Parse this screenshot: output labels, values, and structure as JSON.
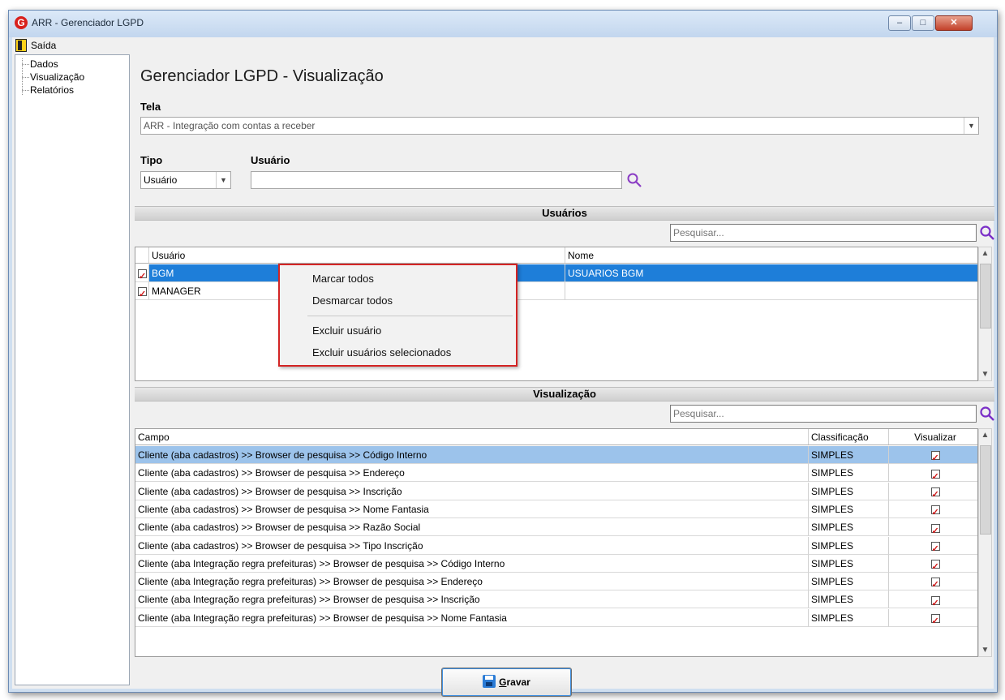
{
  "window": {
    "title": "ARR - Gerenciador LGPD",
    "logo_letter": "G",
    "controls": {
      "minimize": "–",
      "maximize": "□",
      "close": "✕"
    }
  },
  "menubar": {
    "exit_label": "Saída"
  },
  "tree": {
    "items": [
      "Dados",
      "Visualização",
      "Relatórios"
    ]
  },
  "page": {
    "title": "Gerenciador LGPD - Visualização"
  },
  "tela": {
    "label": "Tela",
    "value": "ARR - Integração com contas a receber"
  },
  "tipo": {
    "label": "Tipo",
    "value": "Usuário"
  },
  "usuario": {
    "label": "Usuário",
    "value": ""
  },
  "users_section": {
    "title": "Usuários",
    "search_placeholder": "Pesquisar...",
    "columns": [
      "Usuário",
      "Nome"
    ],
    "rows": [
      {
        "checked": true,
        "user": "BGM",
        "name": "USUARIOS BGM"
      },
      {
        "checked": true,
        "user": "MANAGER",
        "name": ""
      }
    ]
  },
  "context_menu": {
    "items": [
      "Marcar todos",
      "Desmarcar todos",
      "Excluir usuário",
      "Excluir usuários selecionados"
    ]
  },
  "view_section": {
    "title": "Visualização",
    "search_placeholder": "Pesquisar...",
    "columns": [
      "Campo",
      "Classificação",
      "Visualizar"
    ],
    "rows": [
      {
        "field": "Cliente (aba cadastros) >> Browser de pesquisa >> Código Interno",
        "class": "SIMPLES",
        "checked": true
      },
      {
        "field": "Cliente (aba cadastros) >> Browser de pesquisa >> Endereço",
        "class": "SIMPLES",
        "checked": true
      },
      {
        "field": "Cliente (aba cadastros) >> Browser de pesquisa >> Inscrição",
        "class": "SIMPLES",
        "checked": true
      },
      {
        "field": "Cliente (aba cadastros) >> Browser de pesquisa >> Nome Fantasia",
        "class": "SIMPLES",
        "checked": true
      },
      {
        "field": "Cliente (aba cadastros) >> Browser de pesquisa >> Razão Social",
        "class": "SIMPLES",
        "checked": true
      },
      {
        "field": "Cliente (aba cadastros) >> Browser de pesquisa >> Tipo Inscrição",
        "class": "SIMPLES",
        "checked": true
      },
      {
        "field": "Cliente (aba Integração regra prefeituras) >> Browser de pesquisa >> Código Interno",
        "class": "SIMPLES",
        "checked": true
      },
      {
        "field": "Cliente (aba Integração regra prefeituras) >> Browser de pesquisa >> Endereço",
        "class": "SIMPLES",
        "checked": true
      },
      {
        "field": "Cliente (aba Integração regra prefeituras) >> Browser de pesquisa >> Inscrição",
        "class": "SIMPLES",
        "checked": true
      },
      {
        "field": "Cliente (aba Integração regra prefeituras) >> Browser de pesquisa >> Nome Fantasia",
        "class": "SIMPLES",
        "checked": true
      }
    ]
  },
  "footer": {
    "save_label": "Gravar"
  },
  "colors": {
    "selection": "#1e7ed9",
    "row_highlight": "#9cc3eb",
    "context_border": "#d32424",
    "check_red": "#d01818"
  }
}
